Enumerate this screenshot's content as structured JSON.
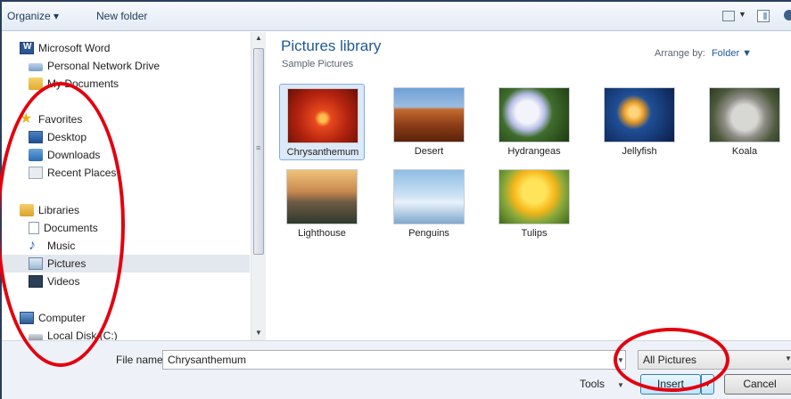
{
  "toolbar": {
    "organize": "Organize ▾",
    "new_folder": "New folder",
    "view_drop": "▼"
  },
  "nav": {
    "items": [
      {
        "label": "Microsoft Word",
        "icon": "word-icon"
      },
      {
        "label": "Personal Network Drive",
        "icon": "network-drive-icon"
      },
      {
        "label": "My Documents",
        "icon": "folder-icon"
      },
      {
        "label": "Favorites",
        "icon": "star-icon"
      },
      {
        "label": "Desktop",
        "icon": "desktop-icon"
      },
      {
        "label": "Downloads",
        "icon": "downloads-icon"
      },
      {
        "label": "Recent Places",
        "icon": "recent-places-icon"
      },
      {
        "label": "Libraries",
        "icon": "libraries-icon"
      },
      {
        "label": "Documents",
        "icon": "document-icon"
      },
      {
        "label": "Music",
        "icon": "music-icon"
      },
      {
        "label": "Pictures",
        "icon": "pictures-icon"
      },
      {
        "label": "Videos",
        "icon": "videos-icon"
      },
      {
        "label": "Computer",
        "icon": "computer-icon"
      },
      {
        "label": "Local Disk (C:)",
        "icon": "disk-icon"
      }
    ],
    "selected": "Pictures"
  },
  "content": {
    "title": "Pictures library",
    "subtitle": "Sample Pictures",
    "arrange_label": "Arrange by:",
    "arrange_value": "Folder ▼",
    "tiles": [
      {
        "label": "Chrysanthemum"
      },
      {
        "label": "Desert"
      },
      {
        "label": "Hydrangeas"
      },
      {
        "label": "Jellyfish"
      },
      {
        "label": "Koala"
      },
      {
        "label": "Lighthouse"
      },
      {
        "label": "Penguins"
      },
      {
        "label": "Tulips"
      }
    ],
    "selected_tile": "Chrysanthemum"
  },
  "bottom": {
    "file_name_label": "File name:",
    "file_name_value": "Chrysanthemum",
    "file_type": "All Pictures",
    "tools": "Tools",
    "insert": "Insert",
    "cancel": "Cancel"
  },
  "colors": {
    "annotation": "#e3000f",
    "title": "#1e5a96",
    "selection": "#dce9f8"
  }
}
